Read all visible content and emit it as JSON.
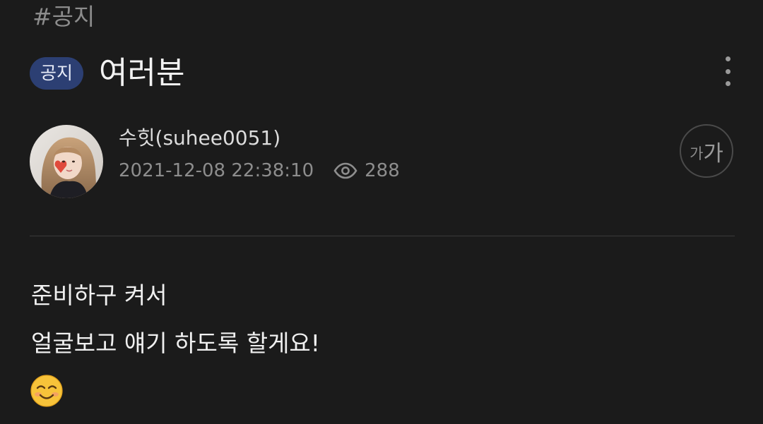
{
  "category_tag": "#공지",
  "post": {
    "badge": "공지",
    "title": "여러분",
    "author": "수힛(suhee0051)",
    "datetime": "2021-12-08 22:38:10",
    "views": "288",
    "body_lines": [
      "준비하구 켜서",
      "얼굴보고 얘기 하도록 할게요!"
    ],
    "emoji_name": "smiling-face-with-blush"
  },
  "font_size_button": {
    "small": "가",
    "big": "가"
  },
  "icons": {
    "more": "more-vertical-icon",
    "views": "eye-icon"
  },
  "colors": {
    "background": "#1b1b1b",
    "badge_bg": "#2c3f73",
    "muted_text": "#8d8d8d",
    "divider": "#3a3a3a"
  }
}
